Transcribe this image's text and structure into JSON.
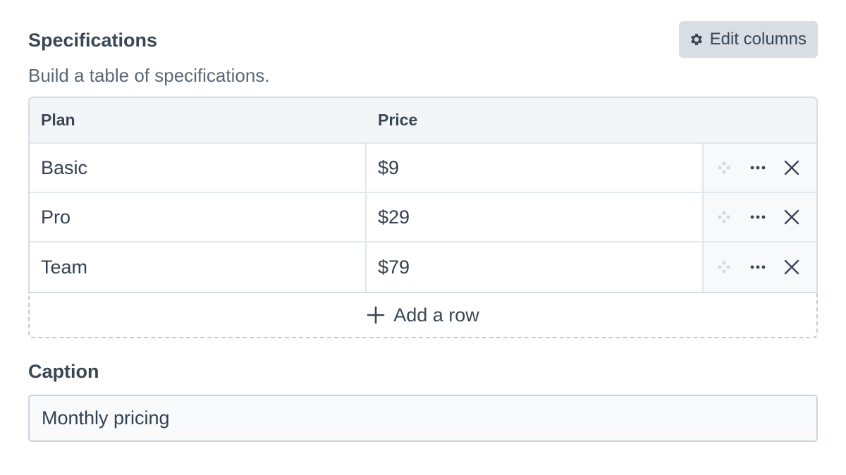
{
  "section": {
    "title": "Specifications",
    "description": "Build a table of specifications.",
    "edit_columns_label": "Edit columns",
    "edit_columns_icon": "gear-icon"
  },
  "table": {
    "columns": [
      "Plan",
      "Price"
    ],
    "rows": [
      {
        "plan": "Basic",
        "price": "$9"
      },
      {
        "plan": "Pro",
        "price": "$29"
      },
      {
        "plan": "Team",
        "price": "$79"
      }
    ],
    "row_actions": [
      "drag-handle-icon",
      "more-icon",
      "close-icon"
    ],
    "add_row_label": "Add a row"
  },
  "caption": {
    "label": "Caption",
    "value": "Monthly pricing"
  },
  "colors": {
    "text": "#334150",
    "header_bg": "#f3f6f9",
    "button_bg": "#d9dee5",
    "border": "#d5dde5"
  }
}
